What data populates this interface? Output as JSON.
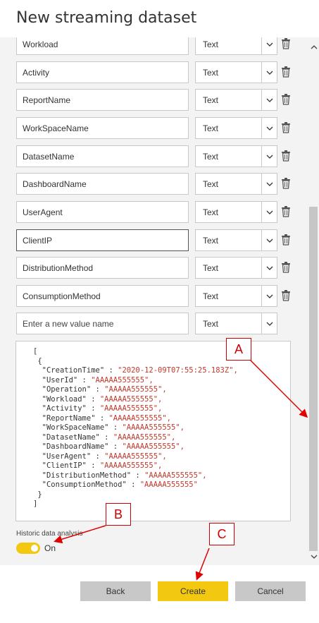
{
  "dialog": {
    "title": "New streaming dataset"
  },
  "fields": [
    {
      "name": "Workload",
      "type": "Text",
      "has_delete": true
    },
    {
      "name": "Activity",
      "type": "Text",
      "has_delete": true
    },
    {
      "name": "ReportName",
      "type": "Text",
      "has_delete": true
    },
    {
      "name": "WorkSpaceName",
      "type": "Text",
      "has_delete": true
    },
    {
      "name": "DatasetName",
      "type": "Text",
      "has_delete": true
    },
    {
      "name": "DashboardName",
      "type": "Text",
      "has_delete": true
    },
    {
      "name": "UserAgent",
      "type": "Text",
      "has_delete": true
    },
    {
      "name": "ClientIP",
      "type": "Text",
      "has_delete": true
    },
    {
      "name": "DistributionMethod",
      "type": "Text",
      "has_delete": true
    },
    {
      "name": "ConsumptionMethod",
      "type": "Text",
      "has_delete": true
    }
  ],
  "new_field": {
    "placeholder": "Enter a new value name",
    "type": "Text"
  },
  "json_preview": {
    "open_bracket": "[",
    "open_brace": "{",
    "entries": [
      {
        "key": "\"CreationTime\"",
        "value": "\"2020-12-09T07:55:25.183Z\","
      },
      {
        "key": "\"UserId\"",
        "value": "\"AAAAA555555\","
      },
      {
        "key": "\"Operation\"",
        "value": "\"AAAAA555555\","
      },
      {
        "key": "\"Workload\"",
        "value": "\"AAAAA555555\","
      },
      {
        "key": "\"Activity\"",
        "value": "\"AAAAA555555\","
      },
      {
        "key": "\"ReportName\"",
        "value": "\"AAAAA555555\","
      },
      {
        "key": "\"WorkSpaceName\"",
        "value": "\"AAAAA555555\","
      },
      {
        "key": "\"DatasetName\"",
        "value": "\"AAAAA555555\","
      },
      {
        "key": "\"DashboardName\"",
        "value": "\"AAAAA555555\","
      },
      {
        "key": "\"UserAgent\"",
        "value": "\"AAAAA555555\","
      },
      {
        "key": "\"ClientIP\"",
        "value": "\"AAAAA555555\","
      },
      {
        "key": "\"DistributionMethod\"",
        "value": "\"AAAAA555555\","
      },
      {
        "key": "\"ConsumptionMethod\"",
        "value": "\"AAAAA555555\""
      }
    ],
    "close_brace": "}",
    "close_bracket": "]"
  },
  "historic": {
    "label": "Historic data analysis",
    "toggle_text": "On",
    "enabled": true
  },
  "buttons": {
    "back": "Back",
    "create": "Create",
    "cancel": "Cancel"
  },
  "callouts": {
    "a": "A",
    "b": "B",
    "c": "C"
  },
  "colors": {
    "accent": "#f2c811",
    "annotation": "#e00000",
    "json_value": "#c0392b"
  }
}
